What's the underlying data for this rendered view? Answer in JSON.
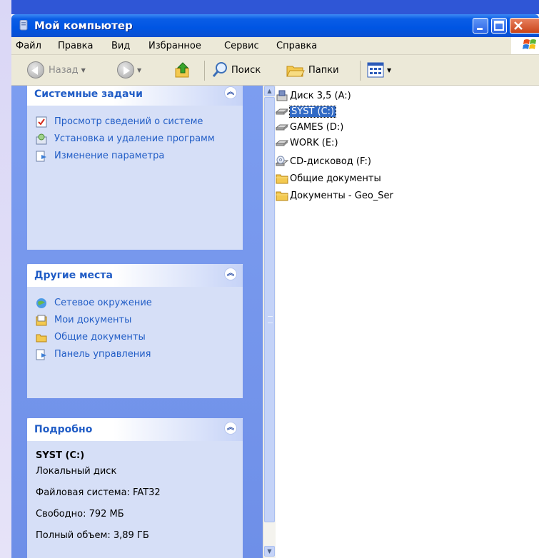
{
  "window": {
    "title": "Мой компьютер"
  },
  "menu": [
    "Файл",
    "Правка",
    "Вид",
    "Избранное",
    "Сервис",
    "Справка"
  ],
  "toolbar": {
    "back_label": "Назад",
    "search_label": "Поиск",
    "folders_label": "Папки"
  },
  "left": {
    "system_tasks": {
      "title": "Системные задачи",
      "items": [
        {
          "label": "Просмотр сведений о системе",
          "icon": "system-info-icon"
        },
        {
          "label": "Установка и удаление программ",
          "icon": "add-remove-programs-icon"
        },
        {
          "label": "Изменение параметра",
          "icon": "change-setting-icon"
        }
      ]
    },
    "other_places": {
      "title": "Другие места",
      "items": [
        {
          "label": "Сетевое окружение",
          "icon": "network-icon"
        },
        {
          "label": "Мои документы",
          "icon": "my-documents-icon"
        },
        {
          "label": "Общие документы",
          "icon": "shared-documents-icon"
        },
        {
          "label": "Панель управления",
          "icon": "control-panel-icon"
        }
      ]
    },
    "details": {
      "title": "Подробно",
      "name": "SYST (C:)",
      "type": "Локальный диск",
      "fs": "Файловая система: FAT32",
      "free": "Свободно: 792 МБ",
      "total": "Полный объем: 3,89 ГБ"
    }
  },
  "files": [
    {
      "label": "Диск 3,5 (A:)",
      "icon": "floppy-drive-icon",
      "selected": false
    },
    {
      "label": "SYST (C:)",
      "icon": "hard-drive-icon",
      "selected": true
    },
    {
      "label": "GAMES (D:)",
      "icon": "hard-drive-icon",
      "selected": false
    },
    {
      "label": "WORK (E:)",
      "icon": "hard-drive-icon",
      "selected": false
    },
    {
      "label": "CD-дисковод (F:)",
      "icon": "cd-drive-icon",
      "selected": false
    },
    {
      "label": "Общие документы",
      "icon": "folder-icon",
      "selected": false
    },
    {
      "label": "Документы - Geo_Ser",
      "icon": "folder-icon",
      "selected": false
    }
  ],
  "colors": {
    "accent": "#215dc6",
    "titlebar": "#0055e3",
    "selection": "#316ac5",
    "taskpane": "#6e8fe8"
  }
}
